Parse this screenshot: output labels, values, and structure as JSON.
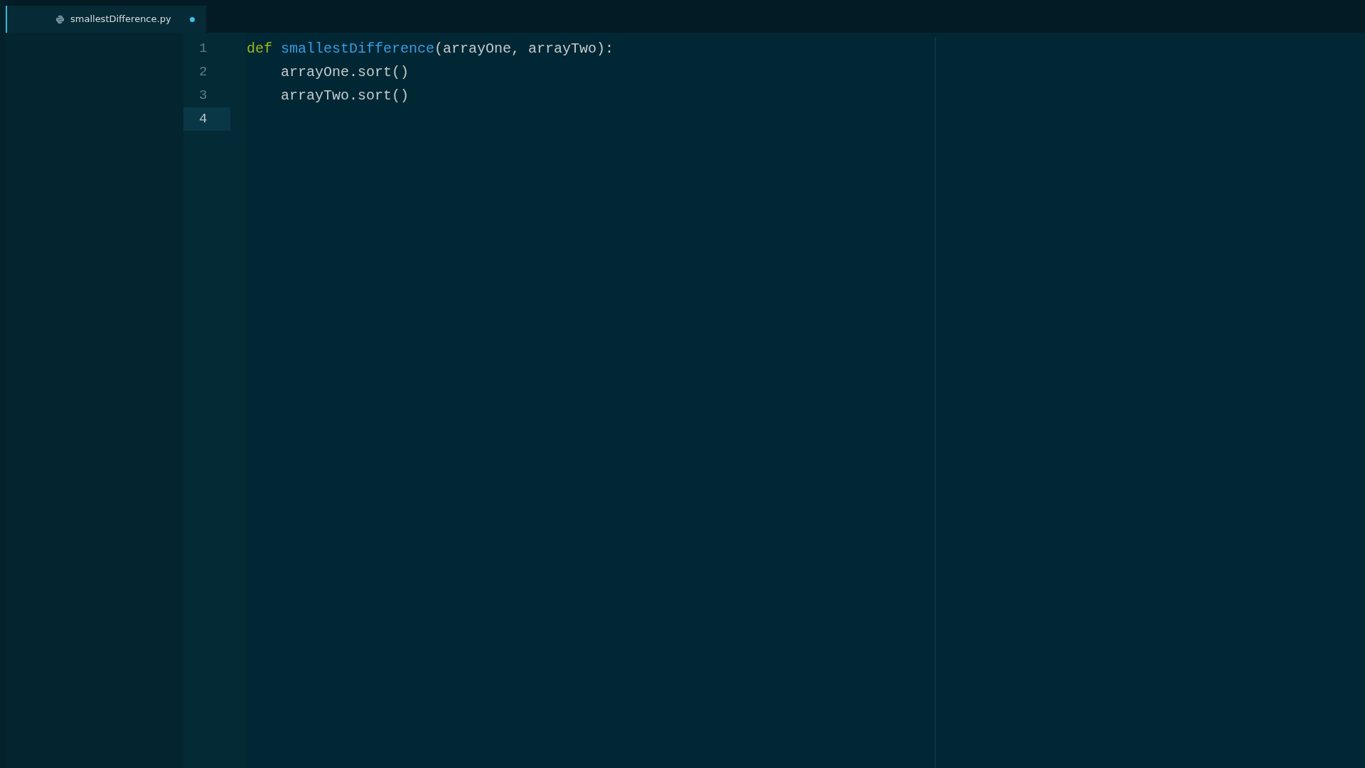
{
  "tabs": [
    {
      "filename": "smallestDifference.py",
      "selected": true,
      "modified": true
    }
  ],
  "editor": {
    "lines": [
      {
        "number": "1",
        "current": false,
        "tokens": [
          {
            "kind": "keyword",
            "text": "def"
          },
          {
            "kind": "function",
            "text": "smallestDifference"
          },
          {
            "kind": "plain",
            "text": "(arrayOne, arrayTwo):"
          }
        ]
      },
      {
        "number": "2",
        "current": false,
        "tokens": [
          {
            "kind": "plain",
            "text": "    arrayOne.sort()"
          }
        ]
      },
      {
        "number": "3",
        "current": false,
        "tokens": [
          {
            "kind": "plain",
            "text": "    arrayTwo.sort()"
          }
        ]
      },
      {
        "number": "4",
        "current": true
      }
    ]
  }
}
